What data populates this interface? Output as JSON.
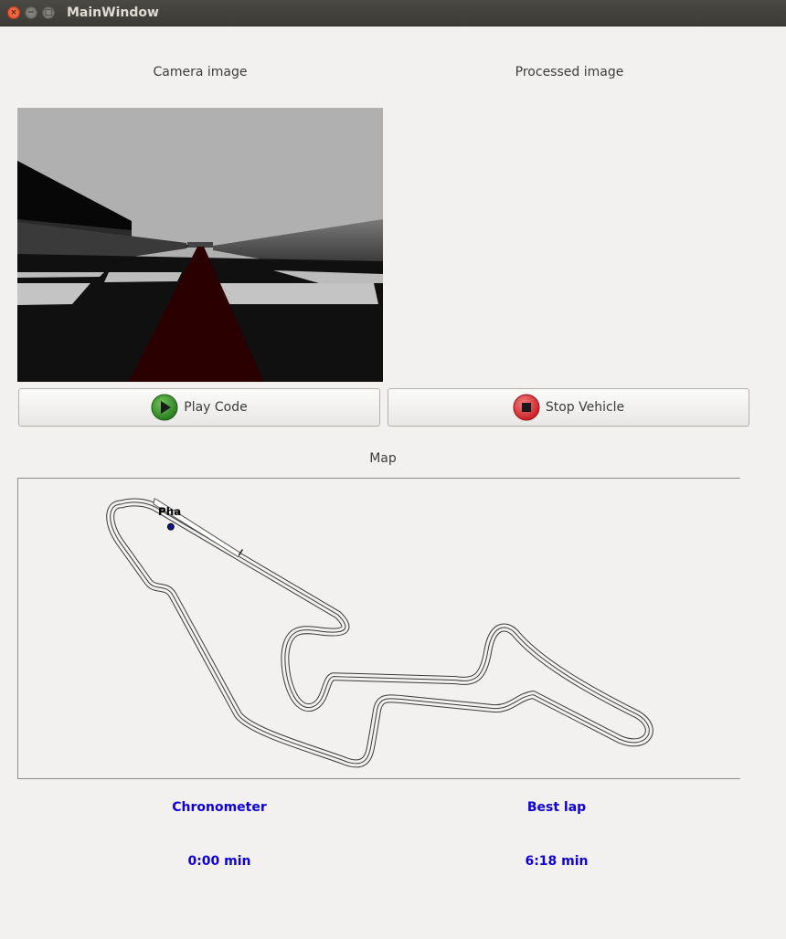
{
  "window": {
    "title": "MainWindow",
    "close_glyph": "×",
    "minimize_glyph": "−",
    "maximize_glyph": "□"
  },
  "labels": {
    "camera": "Camera image",
    "processed": "Processed image",
    "map": "Map"
  },
  "buttons": {
    "play": "Play Code",
    "stop": "Stop Vehicle"
  },
  "map": {
    "marker_label": "Pha"
  },
  "stats": {
    "chronometer_label": "Chronometer",
    "chronometer_value": "0:00 min",
    "best_lap_label": "Best lap",
    "best_lap_value": "6:18 min"
  },
  "colors": {
    "stat_text": "#0f00d9",
    "play_icon": "#3d9a2b",
    "stop_icon": "#e0373c"
  }
}
